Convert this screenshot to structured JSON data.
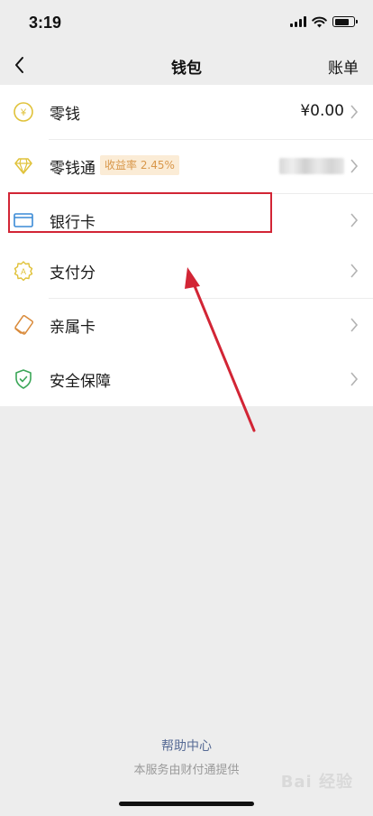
{
  "status_bar": {
    "time": "3:19",
    "battery_level": 0.75
  },
  "nav": {
    "title": "钱包",
    "right_action": "账单",
    "back_icon": "chevron-left-icon"
  },
  "wallet_items": {
    "change": {
      "label": "零钱",
      "value": "¥0.00",
      "icon": "yuan-coin-icon",
      "icon_color": "#e0c23a"
    },
    "licaitong": {
      "label": "零钱通",
      "badge": "收益率 2.45%",
      "icon": "diamond-icon",
      "icon_color": "#e0c23a"
    },
    "bank_card": {
      "label": "银行卡",
      "icon": "bank-card-icon",
      "icon_color": "#3a8ad6"
    }
  },
  "credit_items": {
    "pay_score": {
      "label": "支付分",
      "icon": "score-badge-icon",
      "icon_color": "#e0c23a"
    },
    "family_card": {
      "label": "亲属卡",
      "icon": "family-card-icon",
      "icon_color": "#d98a3a"
    }
  },
  "security_items": {
    "security": {
      "label": "安全保障",
      "icon": "shield-check-icon",
      "icon_color": "#3aa657"
    }
  },
  "footer": {
    "help_link": "帮助中心",
    "provider_note": "本服务由财付通提供",
    "watermark": "Bai 经验"
  },
  "colors": {
    "highlight": "#d22535",
    "arrow": "#d22535",
    "link": "#576b95"
  }
}
